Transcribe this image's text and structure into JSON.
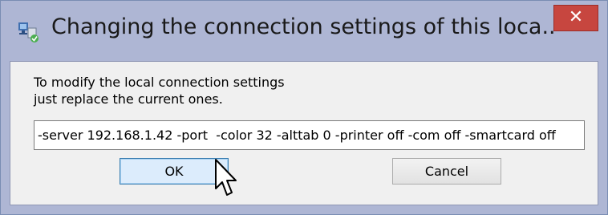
{
  "window": {
    "title": "Changing the connection settings of this loca...",
    "close_label": "✕"
  },
  "dialog": {
    "instruction_line1": "To modify the local connection settings",
    "instruction_line2": "just replace the current ones.",
    "settings_value": "-server 192.168.1.42 -port  -color 32 -alttab 0 -printer off -com off -smartcard off",
    "ok_label": "OK",
    "cancel_label": "Cancel"
  },
  "colors": {
    "titlebar": "#aeb6d4",
    "close_button": "#c7463f",
    "dialog_background": "#f0f0f0",
    "default_button": "#dcecfc"
  },
  "icons": {
    "app": "remote-connection-icon",
    "close": "close-icon",
    "cursor": "mouse-pointer-icon"
  }
}
